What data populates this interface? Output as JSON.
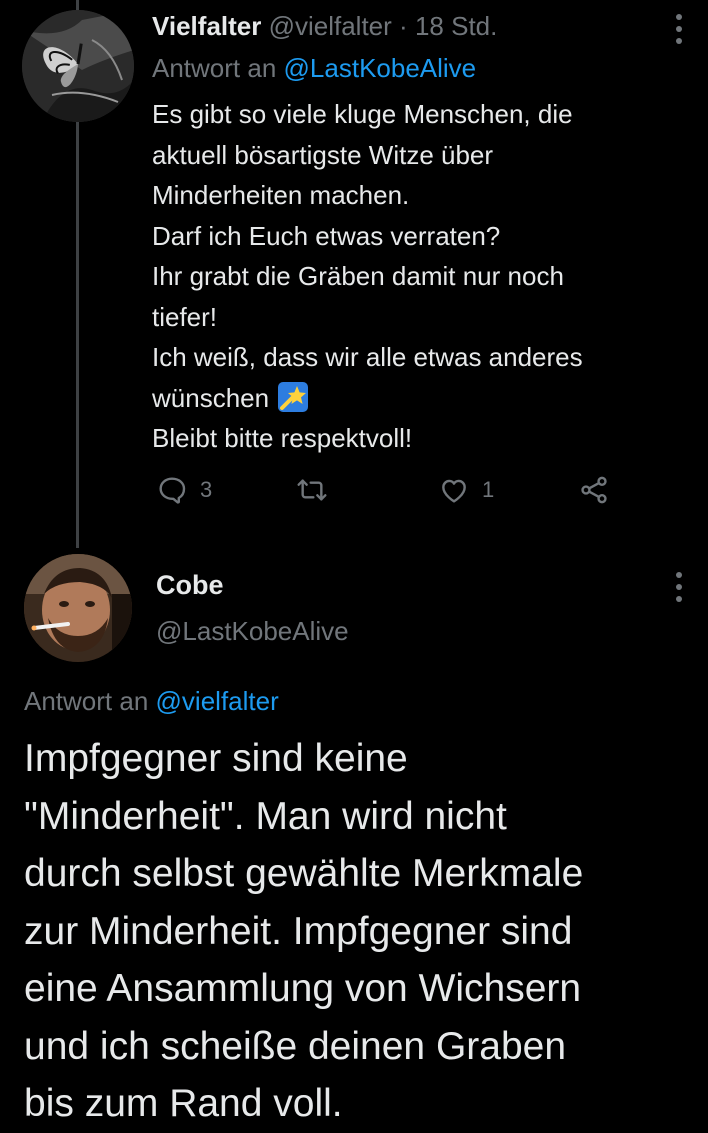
{
  "colors": {
    "background": "#000000",
    "text_primary": "#e7e9ea",
    "text_secondary": "#71767b",
    "link": "#1d9bf0",
    "thread_line": "#3e4144"
  },
  "reply_tweet": {
    "author_name": "Vielfalter",
    "author_handle": "@vielfalter",
    "separator": "·",
    "time": "18 Std.",
    "reply_prefix": "Antwort an",
    "reply_to": "@LastKobeAlive",
    "body_lines": [
      "Es gibt so viele kluge Menschen, die",
      "aktuell bösartigste Witze über",
      "Minderheiten machen.",
      "Darf ich Euch etwas verraten?",
      "Ihr grabt die Gräben damit nur noch",
      "tiefer!",
      "Ich weiß, dass wir alle etwas anderes",
      "wünschen",
      "Bleibt bitte respektvoll!"
    ],
    "emoji": "shooting-star-emoji",
    "actions": {
      "replies": "3",
      "retweets": "",
      "likes": "1"
    },
    "icons": [
      "reply-icon",
      "retweet-icon",
      "like-icon",
      "share-icon",
      "more-icon"
    ]
  },
  "main_tweet": {
    "author_name": "Cobe",
    "author_handle": "@LastKobeAlive",
    "reply_prefix": "Antwort an",
    "reply_to": "@vielfalter",
    "body_lines": [
      "Impfgegner sind keine",
      "\"Minderheit\". Man wird nicht",
      "durch selbst gewählte Merkmale",
      "zur Minderheit. Impfgegner sind",
      "eine Ansammlung von Wichsern",
      "und ich scheiße deinen Graben",
      "bis zum Rand voll."
    ]
  }
}
